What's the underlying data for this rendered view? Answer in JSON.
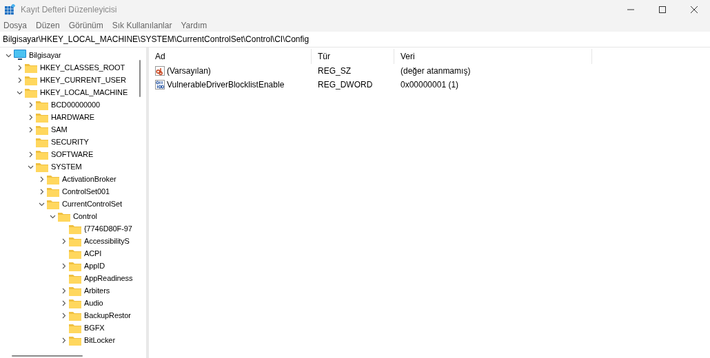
{
  "window": {
    "title": "Kayıt Defteri Düzenleyicisi"
  },
  "menu": [
    "Dosya",
    "Düzen",
    "Görünüm",
    "Sık Kullanılanlar",
    "Yardım"
  ],
  "address": "Bilgisayar\\HKEY_LOCAL_MACHINE\\SYSTEM\\CurrentControlSet\\Control\\CI\\Config",
  "tree": [
    {
      "label": "Bilgisayar",
      "kind": "computer",
      "expanded": true,
      "children": [
        {
          "label": "HKEY_CLASSES_ROOT",
          "kind": "branch",
          "expanded": false
        },
        {
          "label": "HKEY_CURRENT_USER",
          "kind": "branch",
          "expanded": false
        },
        {
          "label": "HKEY_LOCAL_MACHINE",
          "kind": "branch",
          "expanded": true,
          "children": [
            {
              "label": "BCD00000000",
              "kind": "branch",
              "expanded": false
            },
            {
              "label": "HARDWARE",
              "kind": "branch",
              "expanded": false
            },
            {
              "label": "SAM",
              "kind": "branch",
              "expanded": false
            },
            {
              "label": "SECURITY",
              "kind": "leaf"
            },
            {
              "label": "SOFTWARE",
              "kind": "branch",
              "expanded": false
            },
            {
              "label": "SYSTEM",
              "kind": "branch",
              "expanded": true,
              "children": [
                {
                  "label": "ActivationBroker",
                  "kind": "branch",
                  "expanded": false
                },
                {
                  "label": "ControlSet001",
                  "kind": "branch",
                  "expanded": false
                },
                {
                  "label": "CurrentControlSet",
                  "kind": "branch",
                  "expanded": true,
                  "children": [
                    {
                      "label": "Control",
                      "kind": "branch",
                      "expanded": true,
                      "children": [
                        {
                          "label": "{7746D80F-97",
                          "kind": "leaf"
                        },
                        {
                          "label": "AccessibilityS",
                          "kind": "branch",
                          "expanded": false
                        },
                        {
                          "label": "ACPI",
                          "kind": "leaf"
                        },
                        {
                          "label": "AppID",
                          "kind": "branch",
                          "expanded": false
                        },
                        {
                          "label": "AppReadiness",
                          "kind": "leaf"
                        },
                        {
                          "label": "Arbiters",
                          "kind": "branch",
                          "expanded": false
                        },
                        {
                          "label": "Audio",
                          "kind": "branch",
                          "expanded": false
                        },
                        {
                          "label": "BackupRestor",
                          "kind": "branch",
                          "expanded": false
                        },
                        {
                          "label": "BGFX",
                          "kind": "leaf"
                        },
                        {
                          "label": "BitLocker",
                          "kind": "branch",
                          "expanded": false
                        }
                      ]
                    }
                  ]
                }
              ]
            }
          ]
        }
      ]
    }
  ],
  "table": {
    "columns": [
      "Ad",
      "Tür",
      "Veri"
    ],
    "rows": [
      {
        "kind": "string",
        "name": "(Varsayılan)",
        "type": "REG_SZ",
        "data": "(değer atanmamış)"
      },
      {
        "kind": "binary",
        "name": "VulnerableDriverBlocklistEnable",
        "type": "REG_DWORD",
        "data": "0x00000001 (1)"
      }
    ]
  }
}
